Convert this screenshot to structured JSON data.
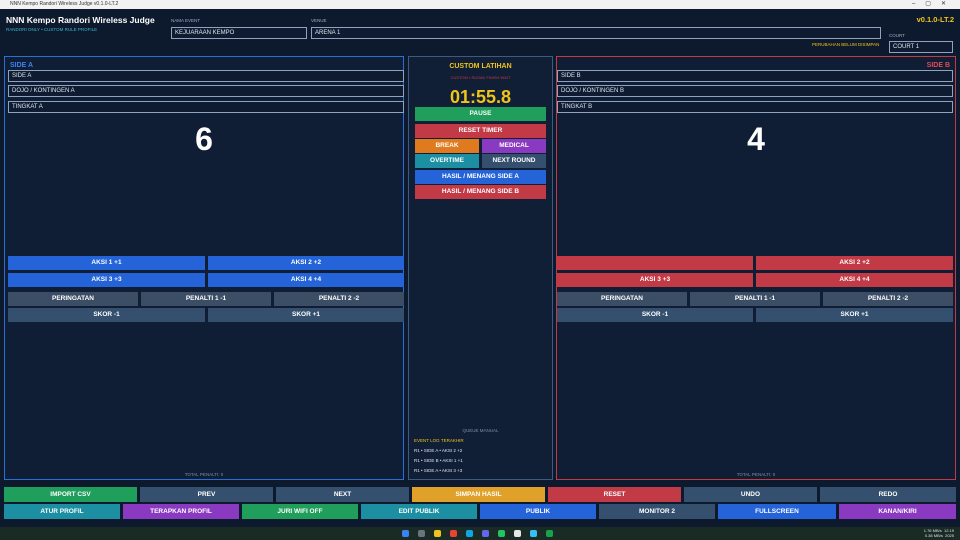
{
  "window": {
    "title": "NNN Kempo Randori Wireless Judge v0.1.0-LT.2"
  },
  "header": {
    "brand": "NNN Kempo Randori Wireless Judge",
    "subtitle": "RANDORI ONLY • CUSTOM RULE PROFILE",
    "event_label": "NAMA EVENT",
    "event_value": "KEJUARAAN KEMPO",
    "venue_label": "VENUE",
    "venue_value": "ARENA 1",
    "version": "v0.1.0-LT.2",
    "court_label": "COURT",
    "court_value": "COURT 1",
    "unsaved": "PERUBAHAN BELUM DISIMPAN"
  },
  "side_a": {
    "title": "SIDE A",
    "name": "SIDE A",
    "team": "DOJO / KONTINGEN A",
    "level": "TINGKAT A",
    "score": "6",
    "aksi1": "AKSI 1  +1",
    "aksi2": "AKSI 2  +2",
    "aksi3": "AKSI 3  +3",
    "aksi4": "AKSI 4  +4",
    "warning": "PERINGATAN",
    "pen1": "PENALTI 1  -1",
    "pen2": "PENALTI 2  -2",
    "skor_minus": "SKOR -1",
    "skor_plus": "SKOR +1",
    "total": "TOTAL PENALTI: 0"
  },
  "side_b": {
    "title": "SIDE B",
    "name": "SIDE B",
    "team": "DOJO / KONTINGEN B",
    "level": "TINGKAT B",
    "score": "4",
    "aksi1": "",
    "aksi2": "AKSI 2  +2",
    "aksi3": "AKSI 3  +3",
    "aksi4": "AKSI 4  +4",
    "warning": "PERINGATAN",
    "pen1": "PENALTI 1  -1",
    "pen2": "PENALTI 2  -2",
    "skor_minus": "SKOR -1",
    "skor_plus": "SKOR +1",
    "total": "TOTAL PENALTI: 0"
  },
  "center": {
    "title": "CUSTOM LATIHAN",
    "subtitle": "CUSTOM • RUSAK FINISH WAIT",
    "timer": "01:55.8",
    "pause": "PAUSE",
    "reset_timer": "RESET TIMER",
    "break": "BREAK",
    "medical": "MEDICAL",
    "overtime": "OVERTIME",
    "next_round": "NEXT ROUND",
    "win_a": "HASIL / MENANG SIDE A",
    "win_b": "HASIL / MENANG SIDE B",
    "manual": "QUEUE MANUAL",
    "log_title": "EVENT LOG TERAKHIR",
    "log": [
      "R1 • SIDE A • AKSI 2 +2",
      "R1 • SIDE B • AKSI 1 +1",
      "R1 • SIDE A • AKSI 3 +3"
    ]
  },
  "bottom_row1": [
    "IMPORT CSV",
    "PREV",
    "NEXT",
    "SIMPAN HASIL",
    "RESET",
    "UNDO",
    "REDO"
  ],
  "bottom_row2": [
    "ATUR PROFIL",
    "TERAPKAN PROFIL",
    "JURI WIFI OFF",
    "EDIT PUBLIK",
    "PUBLIK",
    "MONITOR 2",
    "FULLSCREEN",
    "KANAN/KIRI"
  ],
  "tray": {
    "line1": "1.76 MB/s",
    "line2": "0.38 MB/s",
    "time": "12.19",
    "date": "2025"
  },
  "colors": {
    "side_a": "#2563d9",
    "side_b": "#c23a46",
    "accent": "#f0c419"
  }
}
